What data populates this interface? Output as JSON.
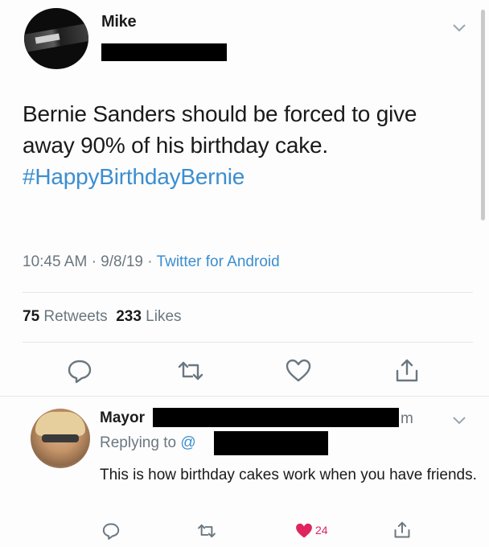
{
  "tweet": {
    "author_name": "Mike",
    "text": "Bernie Sanders should be forced to give away 90% of his birthday cake.",
    "hashtag": "#HappyBirthdayBernie",
    "time": "10:45 AM",
    "date": "9/8/19",
    "source": "Twitter for Android",
    "retweet_count": "75",
    "retweet_label": "Retweets",
    "like_count": "233",
    "like_label": "Likes"
  },
  "reply": {
    "author_name": "Mayor",
    "time_suffix": "m",
    "replying_prefix": "Replying to",
    "replying_handle": "@",
    "text": "This is how birthday cakes work when you have friends.",
    "like_count": "24"
  },
  "icons": {
    "reply": "reply-icon",
    "retweet": "retweet-icon",
    "like": "heart-icon",
    "share": "share-icon",
    "menu": "chevron-down-icon"
  },
  "colors": {
    "link": "#3b8ed0",
    "muted": "#6b7780",
    "liked": "#e0245e"
  },
  "separator": "·"
}
